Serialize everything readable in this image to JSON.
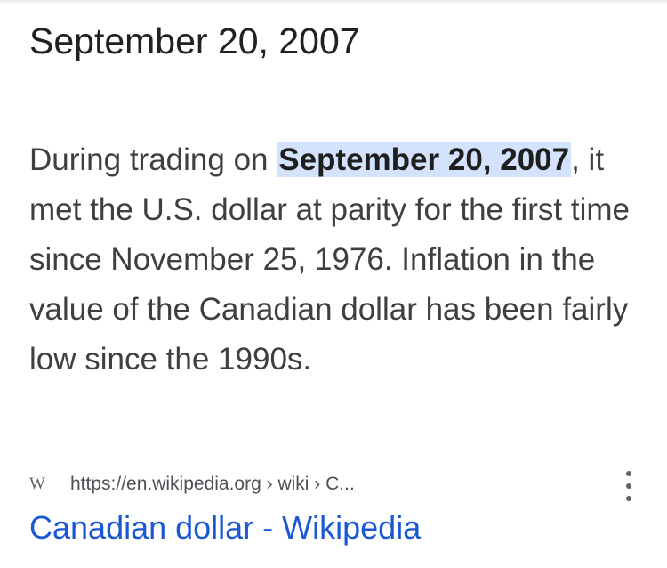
{
  "answer": {
    "title": "September 20, 2007"
  },
  "snippet": {
    "before": "During trading on ",
    "highlight": "September 20, 2007",
    "after": ", it met the U.S. dollar at parity for the first time since November 25, 1976. Inflation in the value of the Canadian dollar has been fairly low since the 1990s."
  },
  "source": {
    "favicon_letter": "W",
    "url": "https://en.wikipedia.org › wiki › C...",
    "more_icon": "more-vert-icon"
  },
  "result": {
    "link_text": "Canadian dollar - Wikipedia"
  },
  "colors": {
    "link": "#1a57d4",
    "highlight": "#d3e3fd"
  }
}
